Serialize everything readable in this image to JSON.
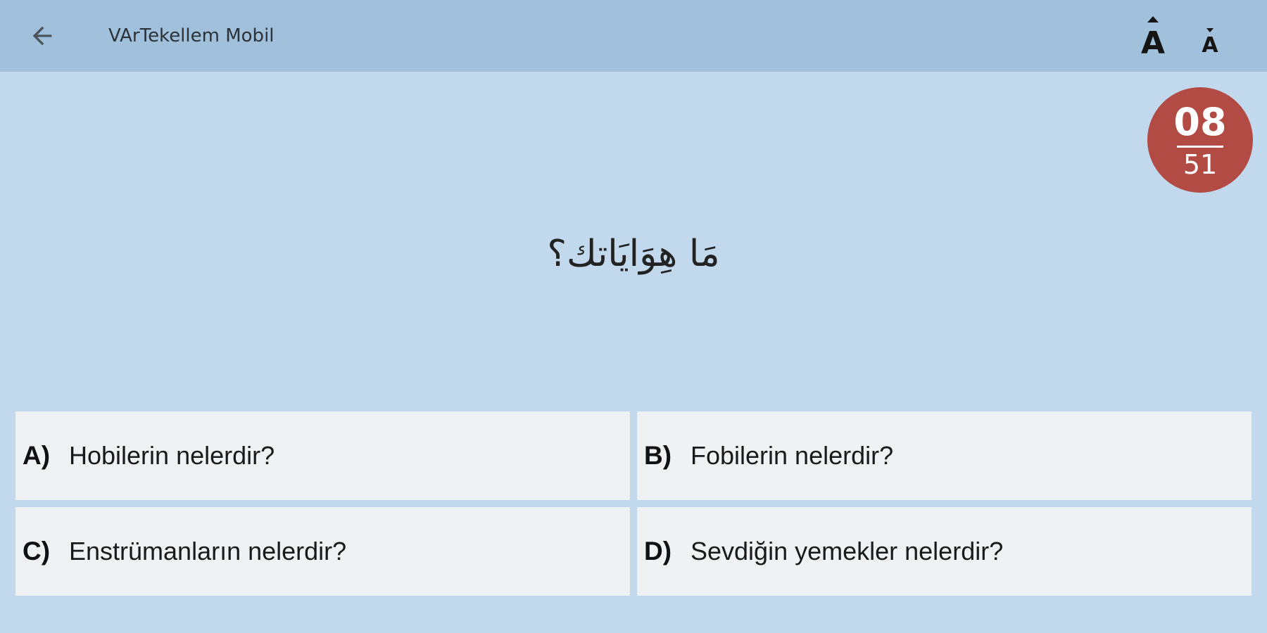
{
  "appbar": {
    "title": "VArTekellem Mobil",
    "back_icon": "arrow-left-icon",
    "font_increase_icon": "font-size-increase-icon",
    "font_decrease_icon": "font-size-decrease-icon",
    "font_increase_glyph": "A",
    "font_decrease_glyph": "A",
    "background_color": "#a0c0db"
  },
  "progress": {
    "current": "08",
    "total": "51",
    "color": "#b24b44"
  },
  "question": {
    "text": "مَا هِوَايَاتك؟"
  },
  "answers": [
    {
      "letter": "A)",
      "text": "Hobilerin nelerdir?"
    },
    {
      "letter": "B)",
      "text": "Fobilerin nelerdir?"
    },
    {
      "letter": "C)",
      "text": "Enstrümanların nelerdir?"
    },
    {
      "letter": "D)",
      "text": "Sevdiğin yemekler nelerdir?"
    }
  ],
  "colors": {
    "page_background": "#c2d8ec",
    "answer_background": "#f0f1f3"
  }
}
